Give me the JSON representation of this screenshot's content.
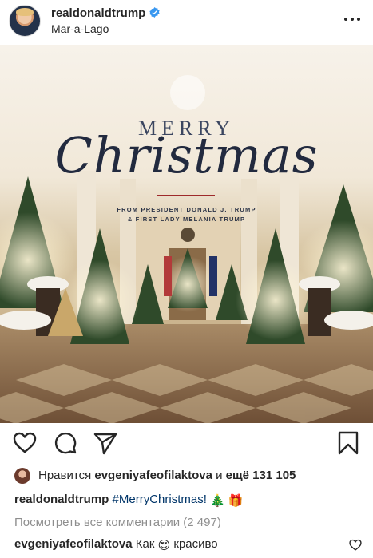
{
  "post_header": {
    "username": "realdonaldtrump",
    "location": "Mar-a-Lago",
    "verified_icon": "verified-badge-icon",
    "more_icon": "more-options-icon"
  },
  "photo": {
    "merry": "MERRY",
    "christmas": "Christmas",
    "from_line_1": "FROM PRESIDENT DONALD J. TRUMP",
    "from_line_2": "& FIRST LADY MELANIA TRUMP"
  },
  "actions": {
    "like_icon": "heart-icon",
    "comment_icon": "comment-icon",
    "share_icon": "share-icon",
    "save_icon": "bookmark-icon"
  },
  "likes": {
    "prefix": "Нравится",
    "user": "evgeniyafeofilaktova",
    "middle": "и",
    "count": "ещё 131 105"
  },
  "caption": {
    "username": "realdonaldtrump",
    "hashtag": "#MerryChristmas!",
    "emoji_1": "🎄",
    "emoji_2": "🎁"
  },
  "view_all_comments": "Посмотреть все комментарии (2 497)",
  "comment": {
    "username": "evgeniyafeofilaktova",
    "text_before": "Как",
    "emoji": "😍",
    "text_after": "красиво"
  },
  "colors": {
    "text": "#262626",
    "secondary": "#8e8e8e",
    "hashtag": "#003569",
    "verified": "#3897f0"
  }
}
